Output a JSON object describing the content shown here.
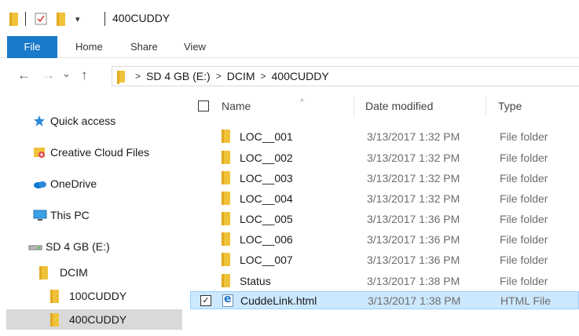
{
  "window": {
    "title": "400CUDDY"
  },
  "qat": {
    "customize_glyph": "▾"
  },
  "ribbon": {
    "tabs": [
      "File",
      "Home",
      "Share",
      "View"
    ]
  },
  "nav": {
    "back": "←",
    "forward": "→",
    "recent": "⌄",
    "up": "↑"
  },
  "address": {
    "segments": [
      "SD 4 GB (E:)",
      "DCIM",
      "400CUDDY"
    ],
    "separator": ">"
  },
  "sidebar": {
    "items": [
      {
        "label": "Quick access",
        "icon": "star-icon"
      },
      {
        "label": "Creative Cloud Files",
        "icon": "creative-cloud-folder-icon"
      },
      {
        "label": "OneDrive",
        "icon": "onedrive-cloud-icon"
      },
      {
        "label": "This PC",
        "icon": "computer-icon"
      },
      {
        "label": "SD 4 GB (E:)",
        "icon": "drive-icon"
      },
      {
        "label": "DCIM",
        "icon": "folder-icon"
      },
      {
        "label": "100CUDDY",
        "icon": "folder-icon"
      },
      {
        "label": "400CUDDY",
        "icon": "folder-icon",
        "selected": true
      }
    ]
  },
  "columns": {
    "name": "Name",
    "date": "Date modified",
    "type": "Type",
    "sort_glyph": "^"
  },
  "files": [
    {
      "name": "LOC__001",
      "date": "3/13/2017 1:32 PM",
      "type": "File folder"
    },
    {
      "name": "LOC__002",
      "date": "3/13/2017 1:32 PM",
      "type": "File folder"
    },
    {
      "name": "LOC__003",
      "date": "3/13/2017 1:32 PM",
      "type": "File folder"
    },
    {
      "name": "LOC__004",
      "date": "3/13/2017 1:32 PM",
      "type": "File folder"
    },
    {
      "name": "LOC__005",
      "date": "3/13/2017 1:36 PM",
      "type": "File folder"
    },
    {
      "name": "LOC__006",
      "date": "3/13/2017 1:36 PM",
      "type": "File folder"
    },
    {
      "name": "LOC__007",
      "date": "3/13/2017 1:36 PM",
      "type": "File folder"
    },
    {
      "name": "Status",
      "date": "3/13/2017 1:38 PM",
      "type": "File folder"
    },
    {
      "name": "CuddeLink.html",
      "date": "3/13/2017 1:38 PM",
      "type": "HTML File",
      "selected": true,
      "checked_glyph": "✓"
    }
  ],
  "colors": {
    "accent": "#1979ca",
    "selection": "#cce8ff",
    "nav_selection": "#d9d9d9",
    "folder": "#f0c23a"
  }
}
